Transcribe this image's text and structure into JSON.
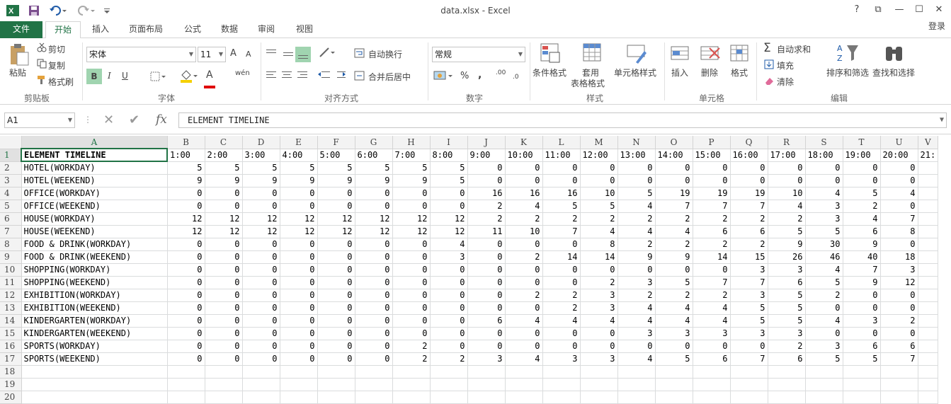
{
  "window": {
    "title": "data.xlsx - Excel",
    "controls": [
      "?",
      "⧉",
      "—",
      "☐",
      "✕"
    ]
  },
  "tabs": {
    "file": "文件",
    "items": [
      "开始",
      "插入",
      "页面布局",
      "公式",
      "数据",
      "审阅",
      "视图"
    ],
    "login": "登录"
  },
  "ribbon": {
    "clipboard": {
      "paste": "粘贴",
      "cut": "剪切",
      "copy": "复制",
      "painter": "格式刷",
      "label": "剪贴板"
    },
    "font": {
      "name": "宋体",
      "size": "11",
      "grow": "A",
      "shrink": "A",
      "bold": "B",
      "italic": "I",
      "underline": "U",
      "color_a": "A",
      "phonetic": "wén",
      "label": "字体"
    },
    "align": {
      "wrap": "自动换行",
      "merge": "合并后居中",
      "label": "对齐方式"
    },
    "number": {
      "format": "常规",
      "percent": "%",
      "comma": ",",
      "inc": ".00",
      "dec": ".0",
      "label": "数字"
    },
    "styles": {
      "cond": "条件格式",
      "table1": "套用",
      "table2": "表格格式",
      "cell": "单元格样式",
      "label": "样式"
    },
    "cells": {
      "insert": "插入",
      "delete": "删除",
      "format": "格式",
      "label": "单元格"
    },
    "editing": {
      "autosum": "自动求和",
      "fill": "填充",
      "clear": "清除",
      "sort": "排序和筛选",
      "find": "查找和选择",
      "label": "编辑"
    },
    "colors": {
      "accent": "#217346"
    }
  },
  "formula_bar": {
    "name_box": "A1",
    "fx": "fx",
    "content": "ELEMENT TIMELINE"
  },
  "sheet": {
    "columns": [
      "A",
      "B",
      "C",
      "D",
      "E",
      "F",
      "G",
      "H",
      "I",
      "J",
      "K",
      "L",
      "M",
      "N",
      "O",
      "P",
      "Q",
      "R",
      "S",
      "T",
      "U",
      "V"
    ],
    "header_row": [
      "ELEMENT TIMELINE",
      "1:00",
      "2:00",
      "3:00",
      "4:00",
      "5:00",
      "6:00",
      "7:00",
      "8:00",
      "9:00",
      "10:00",
      "11:00",
      "12:00",
      "13:00",
      "14:00",
      "15:00",
      "16:00",
      "17:00",
      "18:00",
      "19:00",
      "20:00",
      "21:"
    ],
    "rows": [
      {
        "n": "2",
        "cells": [
          "HOTEL(WORKDAY)",
          "5",
          "5",
          "5",
          "5",
          "5",
          "5",
          "5",
          "5",
          "0",
          "0",
          "0",
          "0",
          "0",
          "0",
          "0",
          "0",
          "0",
          "0",
          "0",
          "0",
          ""
        ]
      },
      {
        "n": "3",
        "cells": [
          "HOTEL(WEEKEND)",
          "9",
          "9",
          "9",
          "9",
          "9",
          "9",
          "9",
          "5",
          "0",
          "0",
          "0",
          "0",
          "0",
          "0",
          "0",
          "0",
          "0",
          "0",
          "0",
          "0",
          ""
        ]
      },
      {
        "n": "4",
        "cells": [
          "OFFICE(WORKDAY)",
          "0",
          "0",
          "0",
          "0",
          "0",
          "0",
          "0",
          "0",
          "16",
          "16",
          "16",
          "10",
          "5",
          "19",
          "19",
          "19",
          "10",
          "4",
          "5",
          "4",
          ""
        ]
      },
      {
        "n": "5",
        "cells": [
          "OFFICE(WEEKEND)",
          "0",
          "0",
          "0",
          "0",
          "0",
          "0",
          "0",
          "0",
          "2",
          "4",
          "5",
          "5",
          "4",
          "7",
          "7",
          "7",
          "4",
          "3",
          "2",
          "0",
          ""
        ]
      },
      {
        "n": "6",
        "cells": [
          "HOUSE(WORKDAY)",
          "12",
          "12",
          "12",
          "12",
          "12",
          "12",
          "12",
          "12",
          "2",
          "2",
          "2",
          "2",
          "2",
          "2",
          "2",
          "2",
          "2",
          "3",
          "4",
          "7",
          ""
        ]
      },
      {
        "n": "7",
        "cells": [
          "HOUSE(WEEKEND)",
          "12",
          "12",
          "12",
          "12",
          "12",
          "12",
          "12",
          "12",
          "11",
          "10",
          "7",
          "4",
          "4",
          "4",
          "6",
          "6",
          "5",
          "5",
          "6",
          "8",
          ""
        ]
      },
      {
        "n": "8",
        "cells": [
          "FOOD & DRINK(WORKDAY)",
          "0",
          "0",
          "0",
          "0",
          "0",
          "0",
          "0",
          "4",
          "0",
          "0",
          "0",
          "8",
          "2",
          "2",
          "2",
          "2",
          "9",
          "30",
          "9",
          "0",
          ""
        ]
      },
      {
        "n": "9",
        "cells": [
          "FOOD & DRINK(WEEKEND)",
          "0",
          "0",
          "0",
          "0",
          "0",
          "0",
          "0",
          "3",
          "0",
          "2",
          "14",
          "14",
          "9",
          "9",
          "14",
          "15",
          "26",
          "46",
          "40",
          "18",
          ""
        ]
      },
      {
        "n": "10",
        "cells": [
          "SHOPPING(WORKDAY)",
          "0",
          "0",
          "0",
          "0",
          "0",
          "0",
          "0",
          "0",
          "0",
          "0",
          "0",
          "0",
          "0",
          "0",
          "0",
          "3",
          "3",
          "4",
          "7",
          "3",
          ""
        ]
      },
      {
        "n": "11",
        "cells": [
          "SHOPPING(WEEKEND)",
          "0",
          "0",
          "0",
          "0",
          "0",
          "0",
          "0",
          "0",
          "0",
          "0",
          "0",
          "2",
          "3",
          "5",
          "7",
          "7",
          "6",
          "5",
          "9",
          "12",
          ""
        ]
      },
      {
        "n": "12",
        "cells": [
          "EXHIBITION(WORKDAY)",
          "0",
          "0",
          "0",
          "0",
          "0",
          "0",
          "0",
          "0",
          "0",
          "2",
          "2",
          "3",
          "2",
          "2",
          "2",
          "3",
          "5",
          "2",
          "0",
          "0",
          ""
        ]
      },
      {
        "n": "13",
        "cells": [
          "EXHIBITION(WEEKEND)",
          "0",
          "0",
          "0",
          "0",
          "0",
          "0",
          "0",
          "0",
          "0",
          "0",
          "2",
          "3",
          "4",
          "4",
          "4",
          "5",
          "5",
          "0",
          "0",
          "0",
          ""
        ]
      },
      {
        "n": "14",
        "cells": [
          "KINDERGARTEN(WORKDAY)",
          "0",
          "0",
          "0",
          "0",
          "0",
          "0",
          "0",
          "0",
          "6",
          "4",
          "4",
          "4",
          "4",
          "4",
          "4",
          "5",
          "5",
          "4",
          "3",
          "2",
          ""
        ]
      },
      {
        "n": "15",
        "cells": [
          "KINDERGARTEN(WEEKEND)",
          "0",
          "0",
          "0",
          "0",
          "0",
          "0",
          "0",
          "0",
          "0",
          "0",
          "0",
          "0",
          "3",
          "3",
          "3",
          "3",
          "3",
          "0",
          "0",
          "0",
          ""
        ]
      },
      {
        "n": "16",
        "cells": [
          "SPORTS(WORKDAY)",
          "0",
          "0",
          "0",
          "0",
          "0",
          "0",
          "2",
          "0",
          "0",
          "0",
          "0",
          "0",
          "0",
          "0",
          "0",
          "0",
          "2",
          "3",
          "6",
          "6",
          ""
        ]
      },
      {
        "n": "17",
        "cells": [
          "SPORTS(WEEKEND)",
          "0",
          "0",
          "0",
          "0",
          "0",
          "0",
          "2",
          "2",
          "3",
          "4",
          "3",
          "3",
          "4",
          "5",
          "6",
          "7",
          "6",
          "5",
          "5",
          "7",
          ""
        ]
      },
      {
        "n": "18",
        "cells": [
          "",
          "",
          "",
          "",
          "",
          "",
          "",
          "",
          "",
          "",
          "",
          "",
          "",
          "",
          "",
          "",
          "",
          "",
          "",
          "",
          "",
          ""
        ]
      },
      {
        "n": "19",
        "cells": [
          "",
          "",
          "",
          "",
          "",
          "",
          "",
          "",
          "",
          "",
          "",
          "",
          "",
          "",
          "",
          "",
          "",
          "",
          "",
          "",
          "",
          ""
        ]
      },
      {
        "n": "20",
        "cells": [
          "",
          "",
          "",
          "",
          "",
          "",
          "",
          "",
          "",
          "",
          "",
          "",
          "",
          "",
          "",
          "",
          "",
          "",
          "",
          "",
          "",
          ""
        ]
      }
    ]
  }
}
